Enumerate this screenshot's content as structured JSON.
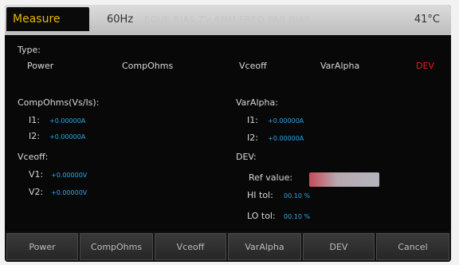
{
  "header": {
    "mode": "Measure",
    "frequency": "60Hz",
    "faded_indicators": "EOUE BIAS ZV 6MM FREQ PAR BIAS",
    "temperature": "41°C"
  },
  "type_section": {
    "label": "Type:",
    "options": [
      "Power",
      "CompOhms",
      "Vceoff",
      "VarAlpha",
      "DEV"
    ],
    "selected": "DEV"
  },
  "compohms": {
    "title": "CompOhms(Vs/Is):",
    "i1_label": "I1:",
    "i1_value": "+0.00000A",
    "i2_label": "I2:",
    "i2_value": "+0.00000A"
  },
  "varalpha": {
    "title": "VarAlpha:",
    "i1_label": "I1:",
    "i1_value": "+0.00000A",
    "i2_label": "I2:",
    "i2_value": "+0.00000A"
  },
  "vceoff": {
    "title": "Vceoff:",
    "v1_label": "V1:",
    "v1_value": "+0.00000V",
    "v2_label": "V2:",
    "v2_value": "+0.00000V"
  },
  "dev": {
    "title": "DEV:",
    "ref_label": "Ref value:",
    "hi_label": "HI tol:",
    "hi_value": "00.10 %",
    "lo_label": "LO tol:",
    "lo_value": "00.10 %"
  },
  "softkeys": [
    "Power",
    "CompOhms",
    "Vceoff",
    "VarAlpha",
    "DEV",
    "Cancel"
  ],
  "colors": {
    "accent": "#e6b800",
    "value": "#2aa8e8",
    "selected": "#e02020",
    "ref_box": "#c84a5a"
  }
}
